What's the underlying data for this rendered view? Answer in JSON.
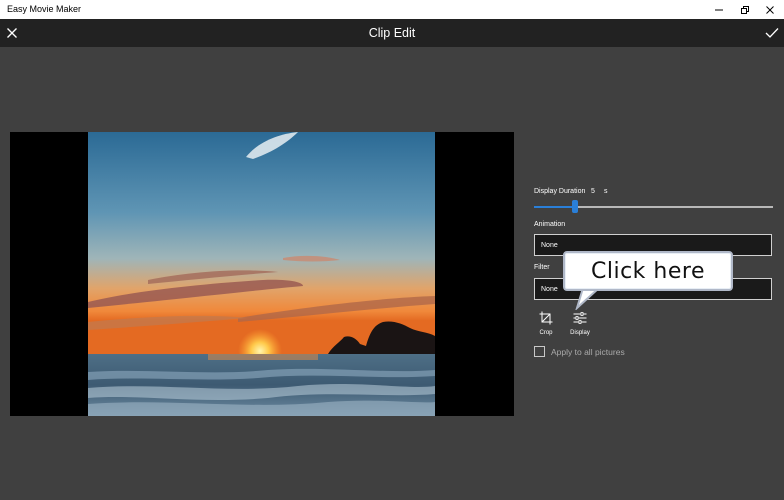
{
  "window": {
    "title": "Easy Movie Maker"
  },
  "header": {
    "title": "Clip Edit",
    "close_icon": "close-icon",
    "confirm_icon": "checkmark-icon"
  },
  "panel": {
    "duration_label": "Display Duration",
    "duration_value": "5",
    "duration_unit": "s",
    "animation_label": "Animation",
    "animation_value": "None",
    "filter_label": "Filter",
    "filter_value": "None",
    "tools": [
      {
        "label": "Crop",
        "icon": "crop-icon"
      },
      {
        "label": "Display",
        "icon": "adjust-sliders-icon"
      }
    ],
    "apply_all_label": "Apply to all pictures",
    "apply_all_checked": false
  },
  "callout": {
    "text": "Click here"
  },
  "colors": {
    "accent": "#2a7fd8",
    "background": "#404040",
    "header": "#222222"
  }
}
